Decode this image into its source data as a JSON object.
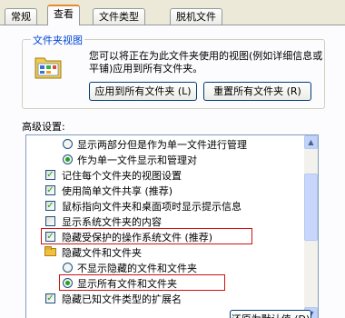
{
  "tabs": [
    "常规",
    "查看",
    "文件类型",
    "脱机文件"
  ],
  "folder_views": {
    "title": "文件夹视图",
    "description": "您可以将正在为此文件夹使用的视图(例如详细信息或平铺)应用到所有文件夹。",
    "apply_all_button": "应用到所有文件夹 (L)",
    "reset_all_button": "重置所有文件夹 (R)"
  },
  "advanced": {
    "label": "高级设置:",
    "items": [
      {
        "type": "radio",
        "checked": false,
        "label": "显示两部分但是作为单一文件进行管理"
      },
      {
        "type": "radio",
        "checked": true,
        "label": "作为单一文件显示和管理对"
      },
      {
        "type": "checkbox",
        "checked": true,
        "label": "记住每个文件夹的视图设置"
      },
      {
        "type": "checkbox",
        "checked": true,
        "label": "使用简单文件共享 (推荐)"
      },
      {
        "type": "checkbox",
        "checked": true,
        "label": "鼠标指向文件夹和桌面项时显示提示信息"
      },
      {
        "type": "checkbox",
        "checked": false,
        "label": "显示系统文件夹的内容"
      },
      {
        "type": "checkbox",
        "checked": true,
        "label": "隐藏受保护的操作系统文件 (推荐)"
      },
      {
        "type": "folder",
        "label": "隐藏文件和文件夹"
      },
      {
        "type": "radio",
        "checked": false,
        "label": "不显示隐藏的文件和文件夹"
      },
      {
        "type": "radio",
        "checked": true,
        "label": "显示所有文件和文件夹"
      },
      {
        "type": "checkbox",
        "checked": true,
        "label": "隐藏已知文件类型的扩展名"
      }
    ]
  },
  "restore_button": "还原为默认值 (D)",
  "colors": {
    "accent_tab": "#e68b2c",
    "group_title": "#0046d5",
    "highlight_box": "#d01010",
    "check": "#21a121"
  }
}
